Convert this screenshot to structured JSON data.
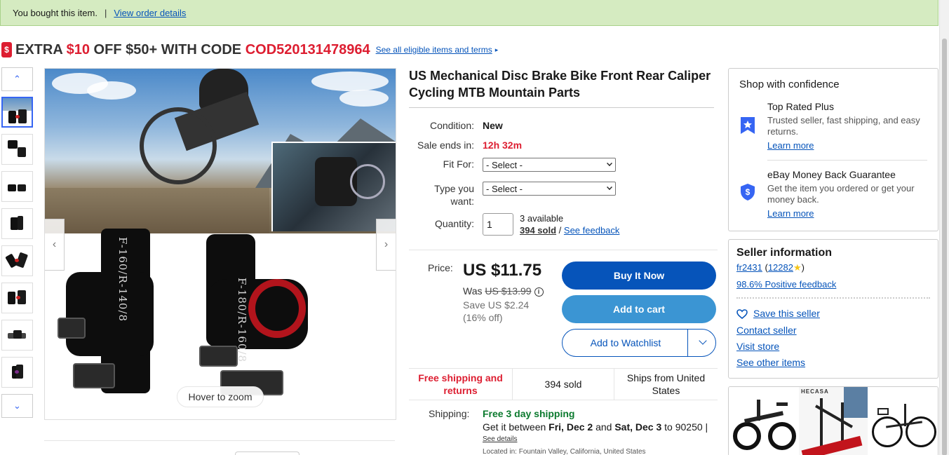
{
  "banner": {
    "text": "You bought this item.",
    "separator": "|",
    "link": "View order details"
  },
  "promo": {
    "tag_glyph": "$",
    "part1": "EXTRA ",
    "amount": "$10",
    "part2": " OFF $50+ WITH CODE ",
    "code": "COD520131478964",
    "link": "See all eligible items and terms",
    "arrow": "▸"
  },
  "gallery": {
    "up_arrow": "⌃",
    "down_arrow": "⌄",
    "prev_arrow": "‹",
    "next_arrow": "›",
    "hover_zoom": "Hover to zoom",
    "label_left": "F-160/R-140/8",
    "label_right": "F-180/R-160/8"
  },
  "product": {
    "title": "US Mechanical Disc Brake Bike Front Rear Caliper Cycling MTB Mountain Parts",
    "condition_label": "Condition:",
    "condition": "New",
    "sale_label": "Sale ends in:",
    "sale_ends": "12h 32m",
    "fit_label": "Fit For:",
    "fit_value": "- Select -",
    "type_label_1": "Type you",
    "type_label_2": "want:",
    "type_value": "- Select -",
    "quantity_label": "Quantity:",
    "quantity_value": "1",
    "available": "3 available",
    "sold": "394 sold",
    "slash": "/",
    "feedback_link": "See feedback"
  },
  "pricing": {
    "price_label": "Price:",
    "price": "US $11.75",
    "was_label": "Was ",
    "was_price": "US $13.99",
    "info": "i",
    "save_line1": "Save US $2.24",
    "save_line2": "(16% off)",
    "buy_now": "Buy It Now",
    "add_to_cart": "Add to cart",
    "add_to_watchlist": "Add to Watchlist"
  },
  "highlights": {
    "free_shipping_1": "Free shipping and",
    "free_shipping_2": "returns",
    "sold": "394 sold",
    "ships_from_1": "Ships from United",
    "ships_from_2": "States"
  },
  "shipping": {
    "label": "Shipping:",
    "headline": "Free 3 day shipping",
    "line_prefix": "Get it between ",
    "date1": "Fri, Dec 2",
    "and": " and ",
    "date2": "Sat, Dec 3",
    "line_suffix": " to 90250 |",
    "details": "See details",
    "location": "Located in: Fountain Valley, California, United States"
  },
  "confidence": {
    "heading": "Shop with confidence",
    "trp_title": "Top Rated Plus",
    "trp_desc": "Trusted seller, fast shipping, and easy returns.",
    "trp_link": "Learn more",
    "mbg_title": "eBay Money Back Guarantee",
    "mbg_desc": "Get the item you ordered or get your money back.",
    "mbg_link": "Learn more"
  },
  "seller": {
    "heading": "Seller information",
    "name": "fr2431",
    "score_open": " (",
    "score": "12282",
    "score_close": ")",
    "star": "★",
    "positive": "98.6% Positive feedback",
    "save_seller": "Save this seller",
    "contact": "Contact seller",
    "visit": "Visit store",
    "other_items": "See other items"
  },
  "ads": {
    "brand": "HECASA"
  },
  "colors": {
    "ebay_blue": "#0654ba",
    "ebay_red": "#dd1e31",
    "banner_green": "#d5ebc1",
    "shipping_green": "#0b7a2e"
  }
}
